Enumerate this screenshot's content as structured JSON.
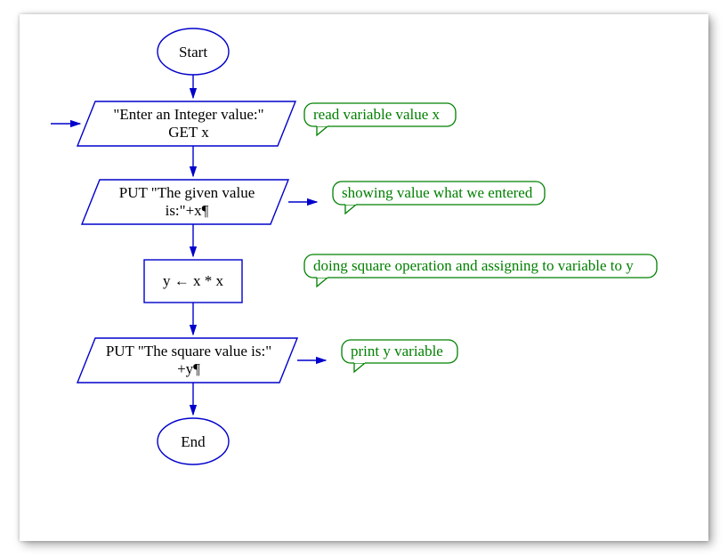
{
  "nodes": {
    "start": {
      "label": "Start"
    },
    "input": {
      "line1": "\"Enter an Integer value:\"",
      "line2": "GET x"
    },
    "output1": {
      "line1": "PUT \"The given value",
      "line2": "is:\"+x¶"
    },
    "process": {
      "line1": "y ← x * x"
    },
    "output2": {
      "line1": "PUT \"The square value is:\"",
      "line2": "+y¶"
    },
    "end": {
      "label": "End"
    }
  },
  "comments": {
    "c1": "read variable value x",
    "c2": "showing value what we entered",
    "c3": "doing square operation and assigning to variable to y",
    "c4": "print y variable"
  }
}
